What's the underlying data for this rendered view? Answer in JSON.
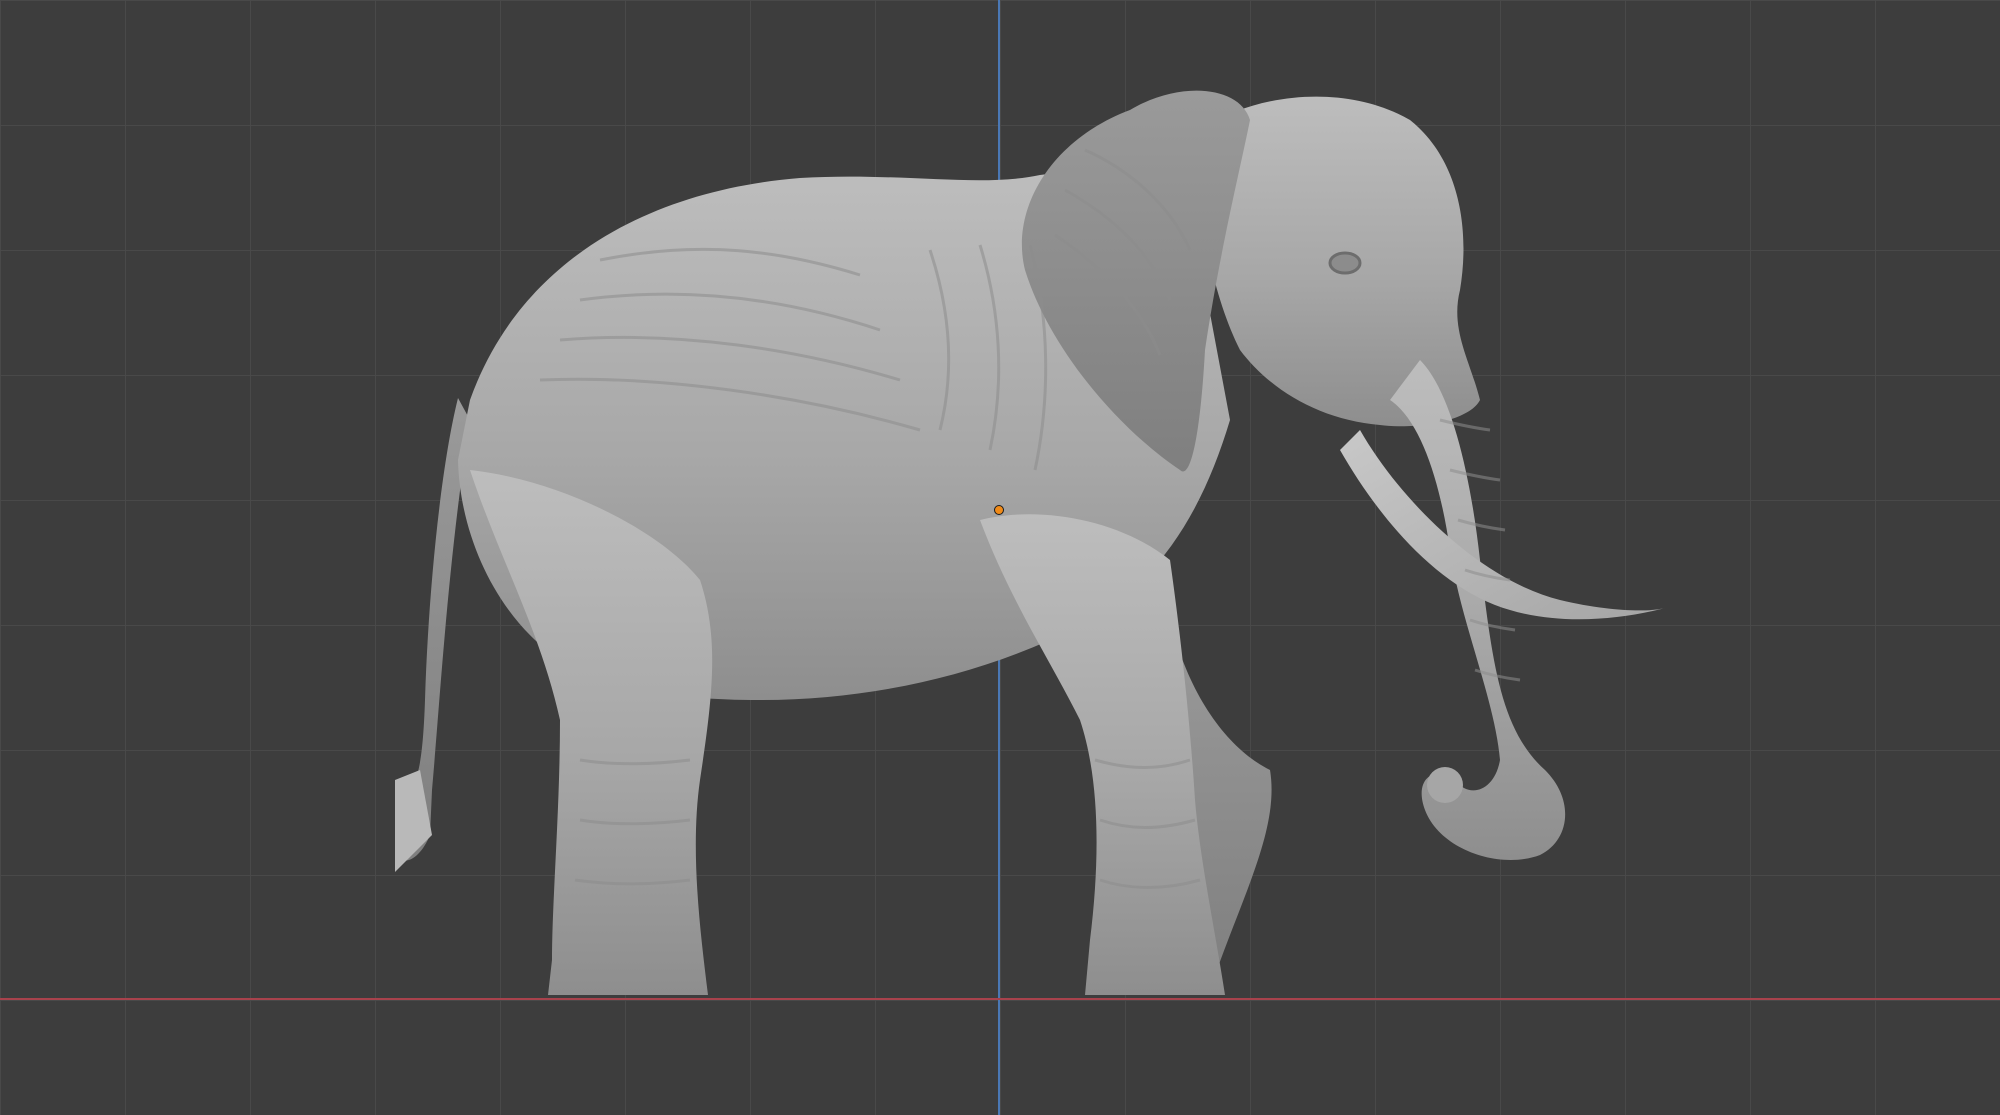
{
  "viewport": {
    "background_color": "#3d3d3d",
    "grid_color": "#4a4a4a",
    "axis_y_color": "#4a78b5",
    "axis_x_color": "#a8424c",
    "origin_color": "#f08a18"
  },
  "model": {
    "subject": "elephant-sculpt",
    "material_color": "#a9a9a9"
  }
}
